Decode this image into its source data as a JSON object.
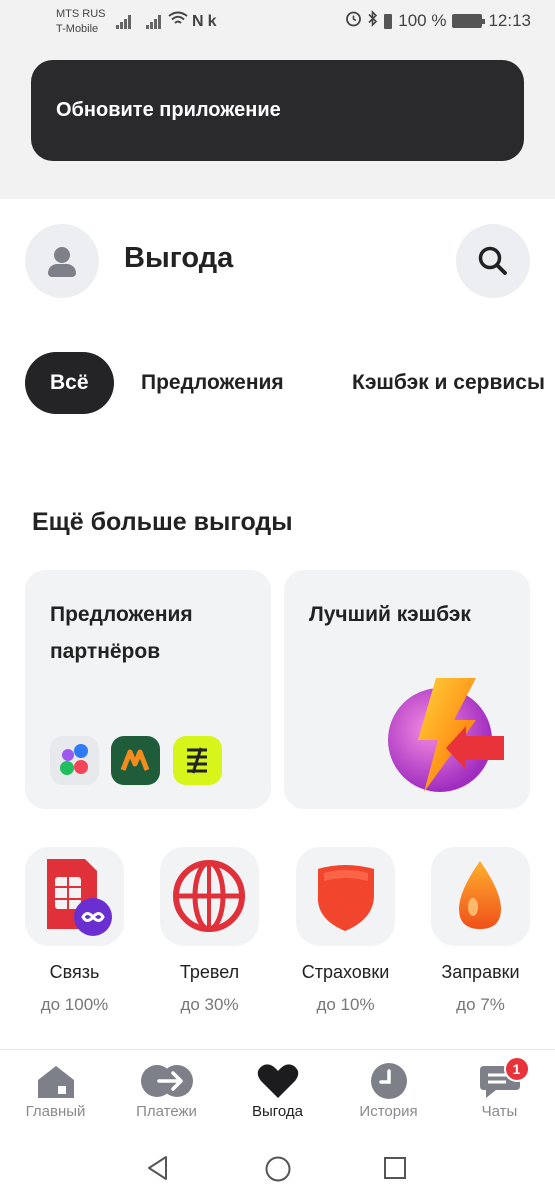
{
  "status_bar": {
    "carrier_1": "MTS RUS",
    "carrier_2": "T-Mobile",
    "battery": "100 %",
    "time": "12:13"
  },
  "banner": {
    "text": "Обновите приложение"
  },
  "header": {
    "title": "Выгода"
  },
  "tabs": [
    {
      "label": "Всё",
      "active": true
    },
    {
      "label": "Предложения",
      "active": false
    },
    {
      "label": "Кэшбэк и сервисы",
      "active": false
    }
  ],
  "section": {
    "title": "Ещё больше выгоды"
  },
  "cards": [
    {
      "title": "Предложения партнёров"
    },
    {
      "title": "Лучший кэшбэк"
    }
  ],
  "categories": [
    {
      "label": "Связь",
      "sub": "до 100%",
      "icon": "sim-card-icon"
    },
    {
      "label": "Тревел",
      "sub": "до 30%",
      "icon": "globe-icon"
    },
    {
      "label": "Страховки",
      "sub": "до 10%",
      "icon": "shield-icon"
    },
    {
      "label": "Заправки",
      "sub": "до 7%",
      "icon": "fuel-drop-icon"
    }
  ],
  "bottom_nav": [
    {
      "label": "Главный",
      "icon": "home-icon"
    },
    {
      "label": "Платежи",
      "icon": "payments-icon"
    },
    {
      "label": "Выгода",
      "icon": "heart-icon",
      "active": true
    },
    {
      "label": "История",
      "icon": "clock-icon"
    },
    {
      "label": "Чаты",
      "icon": "chat-icon",
      "badge": "1"
    }
  ],
  "colors": {
    "accent": "#e8333a",
    "dark": "#2a2a2c",
    "card_bg": "#f2f3f5"
  }
}
